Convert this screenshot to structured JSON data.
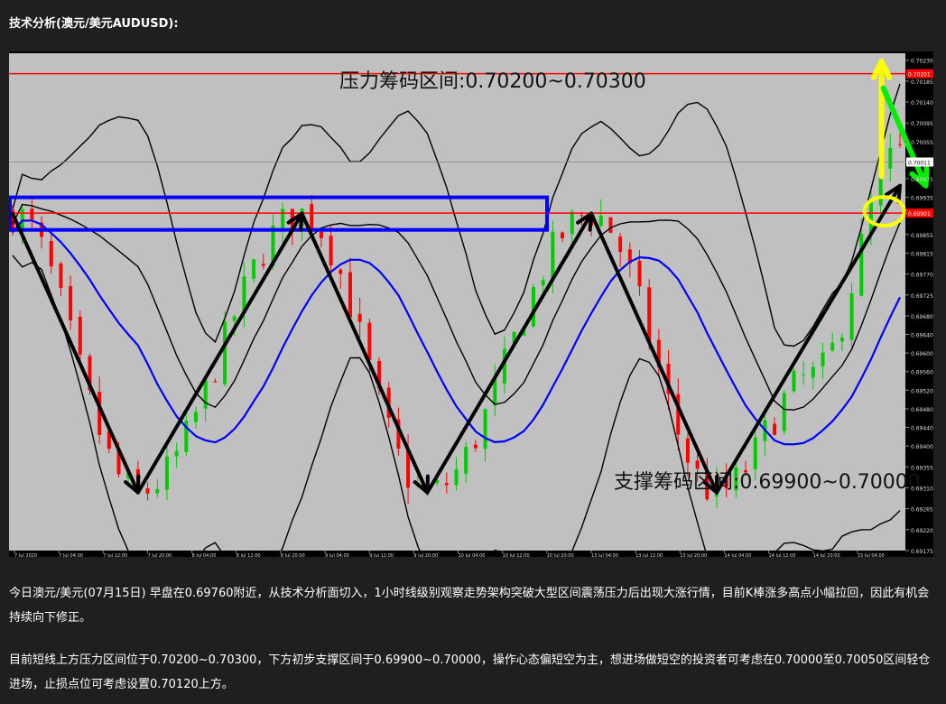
{
  "heading": "技术分析(澳元/美元AUDUSD):",
  "paragraphs": [
    "今日澳元/美元(07月15日) 早盘在0.69760附近，从技术分析面切入，1小时线级别观察走势架构突破大型区间震荡压力后出现大涨行情，目前K棒涨多高点小幅拉回，因此有机会持续向下修正。",
    "目前短线上方压力区间位于0.70200~0.70300，下方初步支撑区间于0.69900~0.70000，操作心态偏短空为主，想进场做短空的投资者可考虑在0.70000至0.70050区间轻仓进场，止损点位可考虑设置0.70120上方。"
  ],
  "chart_data": {
    "type": "candlestick",
    "instrument": "AUDUSD",
    "timeframe": "H1",
    "ylim": [
      0.69175,
      0.70245
    ],
    "y_ticks": [
      0.7023,
      0.70185,
      0.7014,
      0.70095,
      0.70055,
      0.70011,
      0.69975,
      0.69935,
      0.699,
      0.69855,
      0.69815,
      0.6977,
      0.69725,
      0.6968,
      0.6964,
      0.696,
      0.6956,
      0.6952,
      0.6948,
      0.6944,
      0.694,
      0.69355,
      0.6931,
      0.69265,
      0.6922,
      0.69175
    ],
    "y_tick_labels": [
      "0.70230",
      "0.70185",
      "0.70140",
      "0.70095",
      "0.70055",
      "0.70011",
      "0.69975",
      "0.69935",
      "0.69900",
      "0.69855",
      "0.69815",
      "0.69770",
      "0.69725",
      "0.69680",
      "0.69640",
      "0.69600",
      "0.69560",
      "0.69520",
      "0.69480",
      "0.69440",
      "0.69400",
      "0.69355",
      "0.69310",
      "0.69265",
      "0.69220",
      "0.69175"
    ],
    "x_tick_labels": [
      "7 Jul 2020",
      "7 Jul 04:00",
      "7 Jul 12:00",
      "7 Jul 20:00",
      "8 Jul 04:00",
      "8 Jul 12:00",
      "8 Jul 20:00",
      "9 Jul 04:00",
      "9 Jul 12:00",
      "9 Jul 20:00",
      "10 Jul 04:00",
      "10 Jul 12:00",
      "10 Jul 20:00",
      "13 Jul 04:00",
      "13 Jul 12:00",
      "13 Jul 20:00",
      "14 Jul 04:00",
      "14 Jul 12:00",
      "14 Jul 20:00",
      "15 Jul 04:00"
    ],
    "current_price_label": "0.70011",
    "resistance_line": 0.70201,
    "resistance_line_label": "0.70201",
    "support_line": 0.69901,
    "support_line_label": "0.69901",
    "annotations": {
      "resistance_text": "压力筹码区间:0.70200~0.70300",
      "support_text": "支撑筹码区间:0.69900~0.70000"
    },
    "price_path": [
      [
        0,
        0.699
      ],
      [
        13,
        0.693
      ],
      [
        30,
        0.699
      ],
      [
        43,
        0.693
      ],
      [
        60,
        0.699
      ],
      [
        73,
        0.693
      ],
      [
        83,
        0.6955
      ],
      [
        92,
        0.7003
      ]
    ],
    "overlays": [
      "Bollinger Bands",
      "Moving Average"
    ],
    "colors": {
      "plot_bg": "#c0c0c0",
      "bull_candle": "#00cc00",
      "bear_candle": "#ff0000",
      "ma_line": "#0000ff",
      "band_line": "#000000",
      "hline": "#ff0000",
      "blue_box": "#0000ff",
      "arrow_black": "#000000",
      "arrow_yellow": "#ffff00",
      "arrow_green": "#00ee00",
      "ellipse": "#ffff00"
    }
  }
}
